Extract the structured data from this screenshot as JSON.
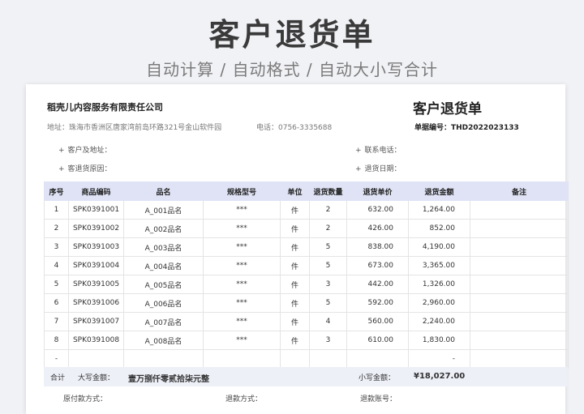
{
  "hero": {
    "title": "客户退货单",
    "subtitle": "自动计算 / 自动格式 / 自动大小写合计"
  },
  "header": {
    "company": "稻壳儿内容服务有限责任公司",
    "address": "地址：珠海市香洲区唐家湾前岛环路321号金山软件园",
    "phone": "电话：0756-3335688",
    "doc_title": "客户退货单",
    "doc_no": "单据编号：THD2022023133"
  },
  "fields": {
    "customer": "客户及地址：",
    "reason": "客退货原因：",
    "contact": "联系电话：",
    "date": "退货日期："
  },
  "table": {
    "headers": [
      "序号",
      "商品编码",
      "品名",
      "规格型号",
      "单位",
      "退货数量",
      "退货单价",
      "退货金额",
      "备注"
    ],
    "rows": [
      [
        "1",
        "SPK0391001",
        "A_001品名",
        "***",
        "件",
        "2",
        "632.00",
        "1,264.00",
        ""
      ],
      [
        "2",
        "SPK0391002",
        "A_002品名",
        "***",
        "件",
        "2",
        "426.00",
        "852.00",
        ""
      ],
      [
        "3",
        "SPK0391003",
        "A_003品名",
        "***",
        "件",
        "5",
        "838.00",
        "4,190.00",
        ""
      ],
      [
        "4",
        "SPK0391004",
        "A_004品名",
        "***",
        "件",
        "5",
        "673.00",
        "3,365.00",
        ""
      ],
      [
        "5",
        "SPK0391005",
        "A_005品名",
        "***",
        "件",
        "3",
        "442.00",
        "1,326.00",
        ""
      ],
      [
        "6",
        "SPK0391006",
        "A_006品名",
        "***",
        "件",
        "5",
        "592.00",
        "2,960.00",
        ""
      ],
      [
        "7",
        "SPK0391007",
        "A_007品名",
        "***",
        "件",
        "4",
        "560.00",
        "2,240.00",
        ""
      ],
      [
        "8",
        "SPK0391008",
        "A_008品名",
        "***",
        "件",
        "3",
        "610.00",
        "1,830.00",
        ""
      ],
      [
        "-",
        "",
        "",
        "",
        "",
        "",
        "",
        "-",
        ""
      ]
    ]
  },
  "totals": {
    "label": "合计",
    "upper_label": "大写金额：",
    "upper_value": "壹万捌仟零贰拾柒元整",
    "lower_label": "小写金额：",
    "lower_value": "¥18,027.00"
  },
  "payment": {
    "original": "原付款方式：",
    "refund_method": "退款方式：",
    "refund_account": "退款账号："
  },
  "colors": {
    "header_bg": "#dfe3f5",
    "total_bg": "#eef0f8"
  }
}
